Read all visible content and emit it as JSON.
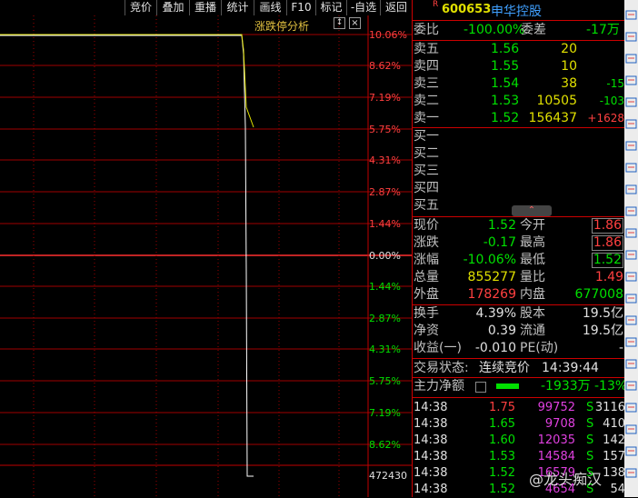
{
  "toolbar": [
    "竞价",
    "叠加",
    "重播",
    "统计",
    "画线",
    "F10",
    "标记",
    "-自选",
    "返回"
  ],
  "panel": {
    "title": "涨跌停分析",
    "arrow": "↕",
    "close": "×"
  },
  "axis": {
    "upper": [
      "10.06%",
      "8.62%",
      "7.19%",
      "5.75%",
      "4.31%",
      "2.87%",
      "1.44%",
      "0.00%"
    ],
    "lower": [
      "1.44%",
      "2.87%",
      "4.31%",
      "5.75%",
      "7.19%",
      "8.62%"
    ],
    "volume_label": "472430"
  },
  "stock": {
    "mark": "R",
    "code": "600653",
    "name": "申华控股"
  },
  "ratio": {
    "label_a": "委比",
    "value_a": "-100.00%",
    "label_b": "委差",
    "value_b": "-17万"
  },
  "asks": [
    {
      "label": "卖五",
      "price": "1.56",
      "vol": "20",
      "chg": ""
    },
    {
      "label": "卖四",
      "price": "1.55",
      "vol": "10",
      "chg": ""
    },
    {
      "label": "卖三",
      "price": "1.54",
      "vol": "38",
      "chg": "-15"
    },
    {
      "label": "卖二",
      "price": "1.53",
      "vol": "10505",
      "chg": "-103"
    },
    {
      "label": "卖一",
      "price": "1.52",
      "vol": "156437",
      "chg": "+1628"
    }
  ],
  "bids": [
    "买一",
    "买二",
    "买三",
    "买四",
    "买五"
  ],
  "expand": "⌃",
  "quote": [
    {
      "l": "现价",
      "v": "1.52",
      "l2": "今开",
      "v2": "1.86"
    },
    {
      "l": "涨跌",
      "v": "-0.17",
      "l2": "最高",
      "v2": "1.86"
    },
    {
      "l": "涨幅",
      "v": "-10.06%",
      "l2": "最低",
      "v2": "1.52"
    },
    {
      "l": "总量",
      "v": "855277",
      "l2": "量比",
      "v2": "1.49"
    },
    {
      "l": "外盘",
      "v": "178269",
      "l2": "内盘",
      "v2": "677008"
    }
  ],
  "fund": [
    {
      "l": "换手",
      "v": "4.39%",
      "l2": "股本",
      "v2": "19.5亿"
    },
    {
      "l": "净资",
      "v": "0.39",
      "l2": "流通",
      "v2": "19.5亿"
    },
    {
      "l": "收益(一)",
      "v": "-0.010",
      "l2": "PE(动)",
      "v2": "-"
    }
  ],
  "status": {
    "label": "交易状态:",
    "value": "连续竞价",
    "time": "14:39:44"
  },
  "main_force": {
    "label": "主力净额",
    "value": "-1933万",
    "pct": "-13%"
  },
  "ticks": [
    {
      "t": "14:38",
      "p": "1.75",
      "v": "99752",
      "s": "S",
      "n": "3116"
    },
    {
      "t": "14:38",
      "p": "1.65",
      "v": "9708",
      "s": "S",
      "n": "410"
    },
    {
      "t": "14:38",
      "p": "1.60",
      "v": "12035",
      "s": "S",
      "n": "142"
    },
    {
      "t": "14:38",
      "p": "1.53",
      "v": "14584",
      "s": "S",
      "n": "157"
    },
    {
      "t": "14:38",
      "p": "1.52",
      "v": "16579",
      "s": "S",
      "n": "138"
    },
    {
      "t": "14:38",
      "p": "1.52",
      "v": "4654",
      "s": "S",
      "n": "54"
    }
  ],
  "watermark": "@龙头痴汉",
  "colors": {
    "grid": "#c00000",
    "price_line": "#ffffff",
    "avg_line": "#e0e000",
    "up": "#ff4040",
    "down": "#00e000"
  }
}
